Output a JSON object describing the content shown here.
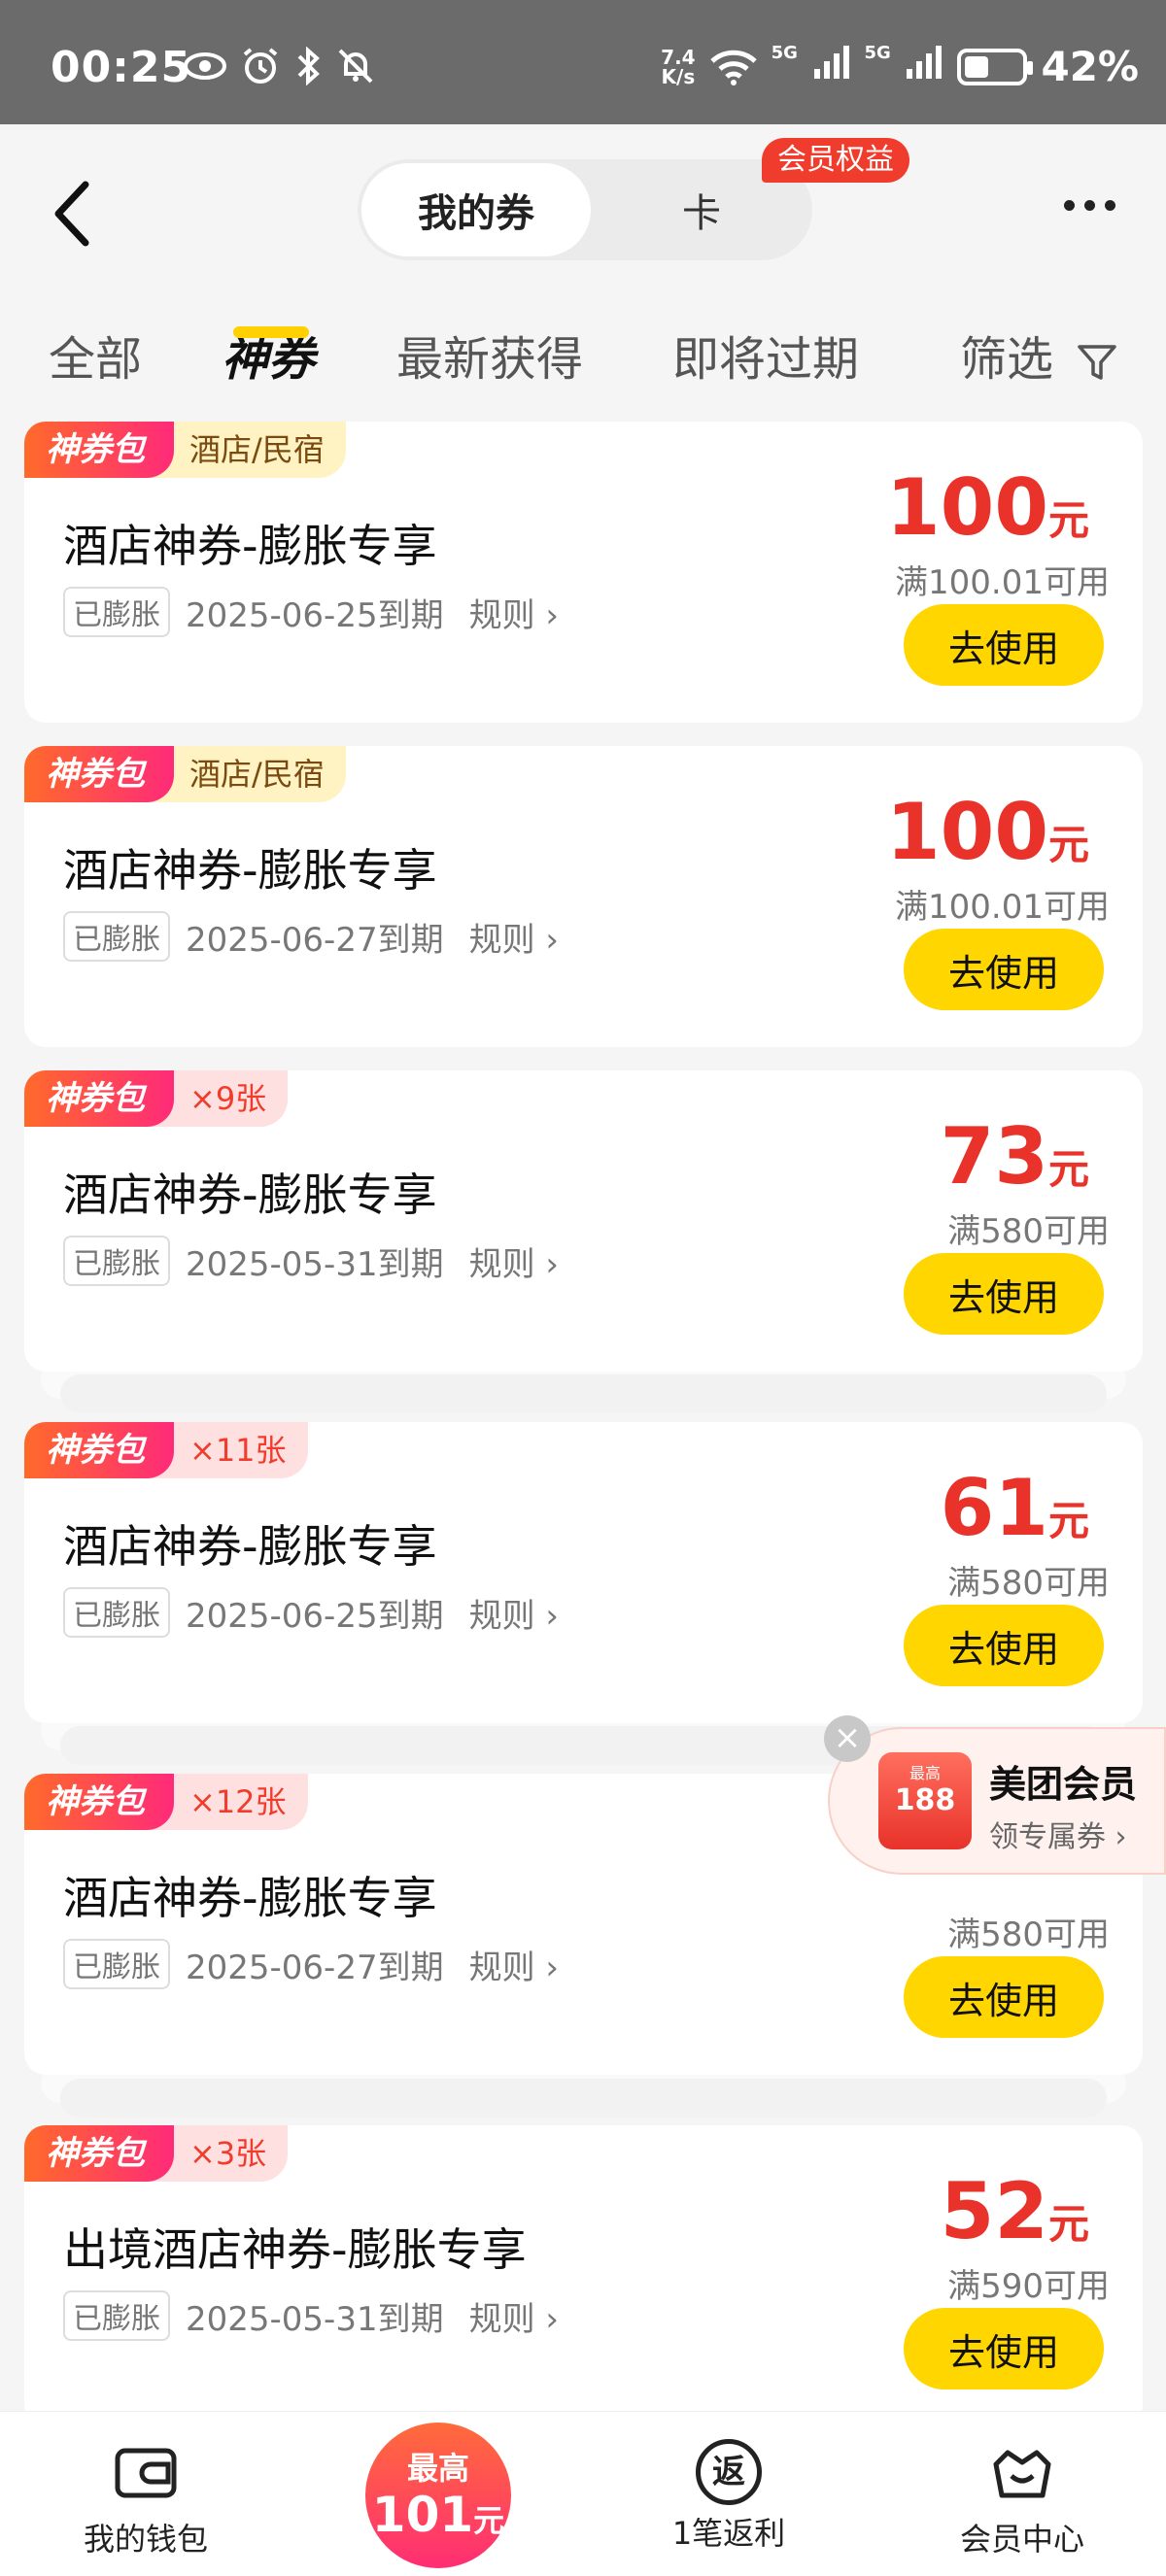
{
  "status_bar": {
    "time": "00:25",
    "net_speed_top": "7.4",
    "net_speed_bottom": "K/s",
    "signal1": "5G",
    "signal2": "5G",
    "battery": "42%",
    "battery_level": 0.42
  },
  "header": {
    "segments": [
      "我的券",
      "卡"
    ],
    "member_badge": "会员权益"
  },
  "tabs": [
    "全部",
    "神券",
    "最新获得",
    "即将过期",
    "筛选"
  ],
  "coupons": [
    {
      "tag": "神券包",
      "sub": "酒店/民宿",
      "title": "酒店神券-膨胀专享",
      "chip": "已膨胀",
      "expiry": "2025-06-25到期",
      "rule": "规则",
      "amount": "100",
      "unit": "元",
      "condition": "满100.01可用",
      "button": "去使用"
    },
    {
      "tag": "神券包",
      "sub": "酒店/民宿",
      "title": "酒店神券-膨胀专享",
      "chip": "已膨胀",
      "expiry": "2025-06-27到期",
      "rule": "规则",
      "amount": "100",
      "unit": "元",
      "condition": "满100.01可用",
      "button": "去使用"
    },
    {
      "tag": "神券包",
      "sub": "×9张",
      "title": "酒店神券-膨胀专享",
      "chip": "已膨胀",
      "expiry": "2025-05-31到期",
      "rule": "规则",
      "amount": "73",
      "unit": "元",
      "condition": "满580可用",
      "button": "去使用"
    },
    {
      "tag": "神券包",
      "sub": "×11张",
      "title": "酒店神券-膨胀专享",
      "chip": "已膨胀",
      "expiry": "2025-06-25到期",
      "rule": "规则",
      "amount": "61",
      "unit": "元",
      "condition": "满580可用",
      "button": "去使用"
    },
    {
      "tag": "神券包",
      "sub": "×12张",
      "title": "酒店神券-膨胀专享",
      "chip": "已膨胀",
      "expiry": "2025-06-27到期",
      "rule": "规则",
      "amount": "",
      "unit": "",
      "condition": "满580可用",
      "button": "去使用"
    },
    {
      "tag": "神券包",
      "sub": "×3张",
      "title": "出境酒店神券-膨胀专享",
      "chip": "已膨胀",
      "expiry": "2025-05-31到期",
      "rule": "规则",
      "amount": "52",
      "unit": "元",
      "condition": "满590可用",
      "button": "去使用"
    }
  ],
  "float_widget": {
    "icon_top": "最高",
    "icon_value": "188",
    "title": "美团会员",
    "subtitle": "领专属券"
  },
  "bottom_nav": {
    "wallet": "我的钱包",
    "center_line1": "最高",
    "center_value": "101",
    "center_unit": "元",
    "rebate_icon": "返",
    "rebate": "1笔返利",
    "member": "会员中心"
  },
  "colors": {
    "accent_yellow": "#ffd600",
    "price_red": "#e8322a",
    "tag_gradient_start": "#ff6a2a",
    "tag_gradient_end": "#ff2a7a"
  }
}
